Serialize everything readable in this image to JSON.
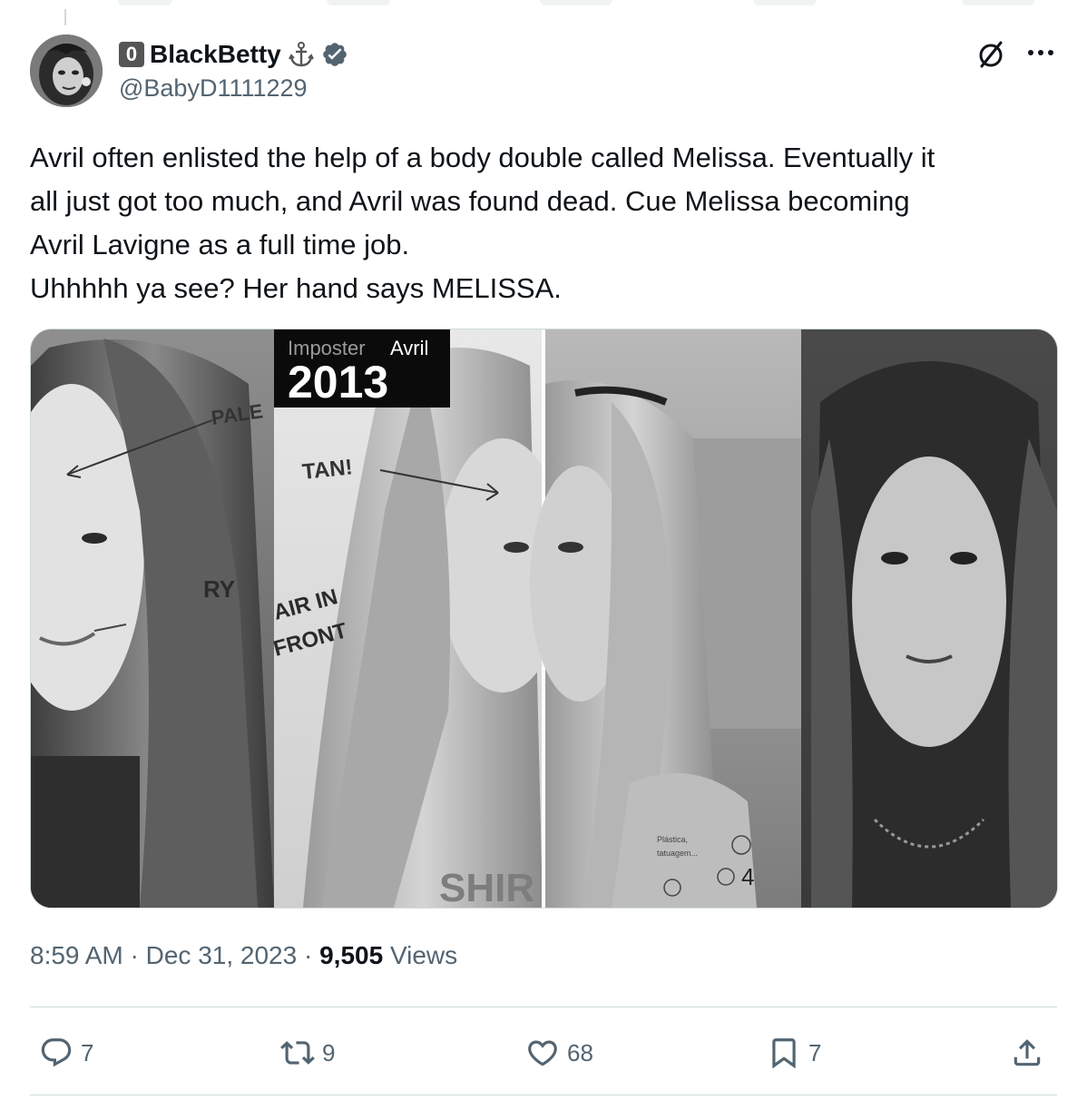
{
  "author": {
    "badge": "0",
    "display_name": "BlackBetty",
    "handle": "@BabyD1111229",
    "name_emoji": "anchor-icon",
    "verified": true
  },
  "tweet": {
    "lines": [
      "Avril often enlisted the help of a body double called Melissa. Eventually it",
      "all just got too much, and Avril was found dead. Cue Melissa becoming",
      "Avril Lavigne as a full time job.",
      "Uhhhhh ya see? Her hand says MELISSA."
    ]
  },
  "media": {
    "overlay_small": "Imposter",
    "overlay_name": "Avril",
    "overlay_year": "2013",
    "annotations": {
      "pale": "PALE",
      "tan": "TAN!",
      "hair_in": "AIR IN",
      "front": "FRONT",
      "ry": "RY",
      "shirt": "SHIR",
      "tattoo_line1": "Plástica,",
      "tattoo_line2": "tatuagem...",
      "num4": "4"
    }
  },
  "meta": {
    "time": "8:59 AM",
    "sep1": " · ",
    "date": "Dec 31, 2023",
    "sep2": " · ",
    "views_count": "9,505",
    "views_label": " Views"
  },
  "actions": {
    "replies": "7",
    "reposts": "9",
    "likes": "68",
    "bookmarks": "7"
  },
  "colors": {
    "text": "#0f1419",
    "secondary": "#536471",
    "border": "#cfd9de",
    "verified": "#536471"
  }
}
